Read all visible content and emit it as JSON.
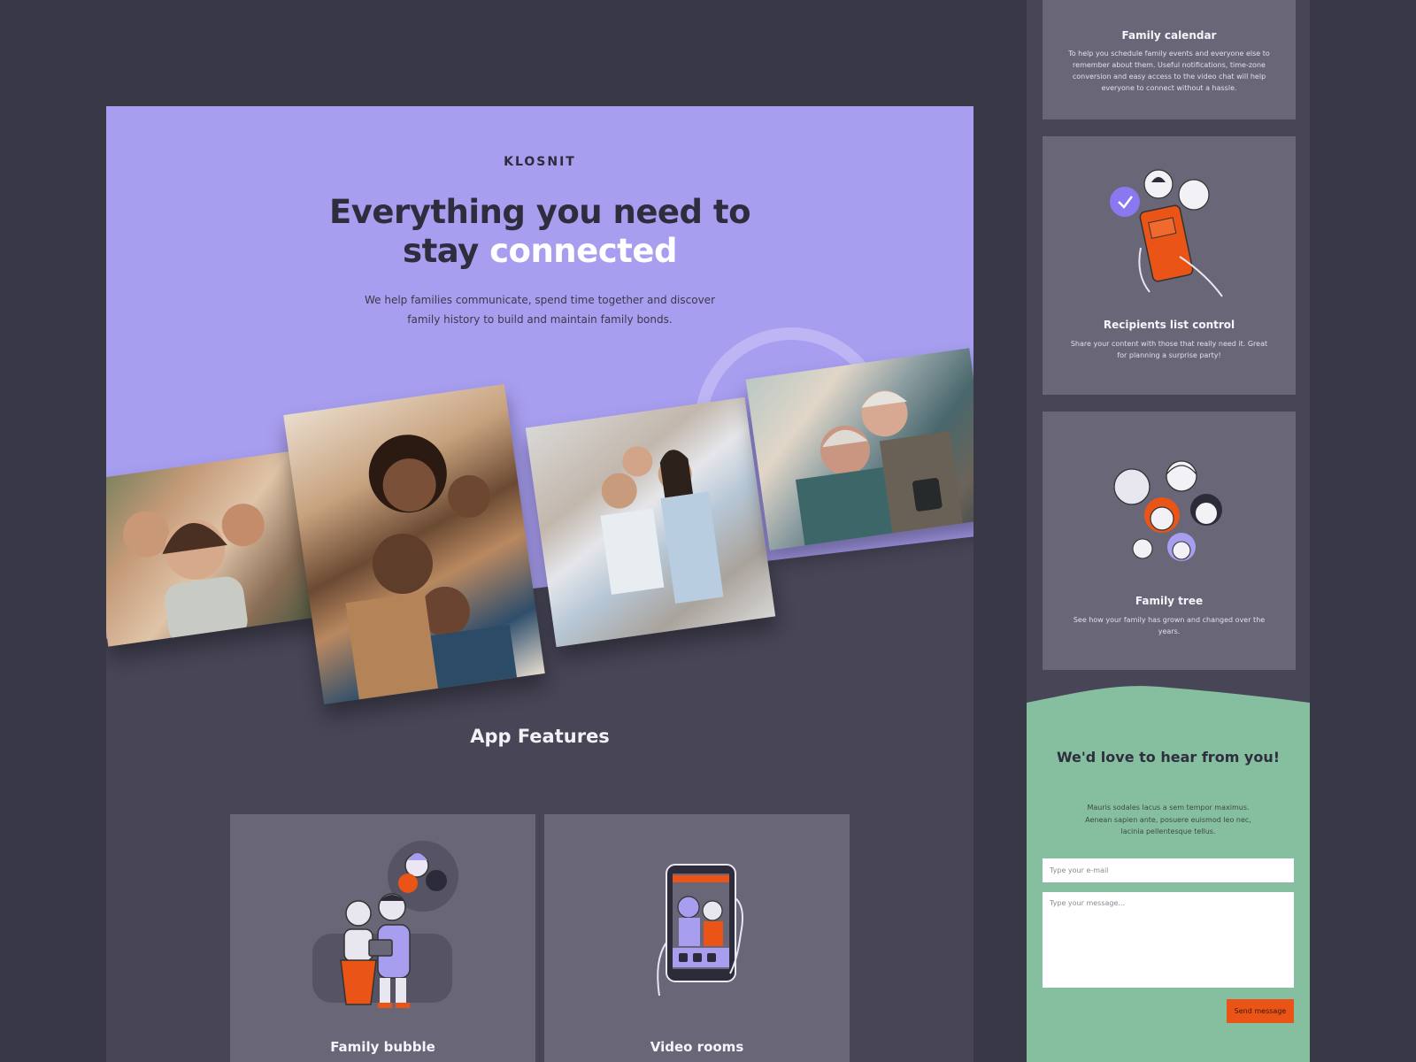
{
  "brand": "KLOSNIT",
  "hero": {
    "headline_line1": "Everything you need to",
    "headline_stay": "stay",
    "headline_highlight": "connected",
    "lead": "We help families communicate, spend time together and discover family history to build and maintain family bonds."
  },
  "features": {
    "title": "App Features",
    "cards": [
      {
        "title": "Family bubble",
        "icon": "family-bubble-illustration"
      },
      {
        "title": "Video rooms",
        "icon": "video-rooms-illustration"
      }
    ]
  },
  "side_cards": [
    {
      "title": "Family calendar",
      "desc": "To help you schedule family events and everyone else to remember about them. Useful notifications, time-zone conversion and easy access to the video chat will help everyone to connect without a hassle."
    },
    {
      "title": "Recipients list control",
      "desc": "Share your content with those that really need it. Great for planning a surprise party!",
      "icon": "recipients-illustration"
    },
    {
      "title": "Family tree",
      "desc": "See how your family has grown and changed over the years.",
      "icon": "family-tree-illustration"
    }
  ],
  "contact": {
    "title": "We'd love to hear from you!",
    "desc": "Mauris sodales lacus a sem tempor maximus. Aenean sapien ante, posuere euismod leo nec, lacinia pellentesque tellus.",
    "email_placeholder": "Type your e-mail",
    "message_placeholder": "Type your message...",
    "send_label": "Send message"
  },
  "colors": {
    "background": "#393847",
    "hero": "#a89ef0",
    "panel": "#474556",
    "card": "#686677",
    "accent": "#ea5416",
    "contact": "#86bf9f"
  }
}
